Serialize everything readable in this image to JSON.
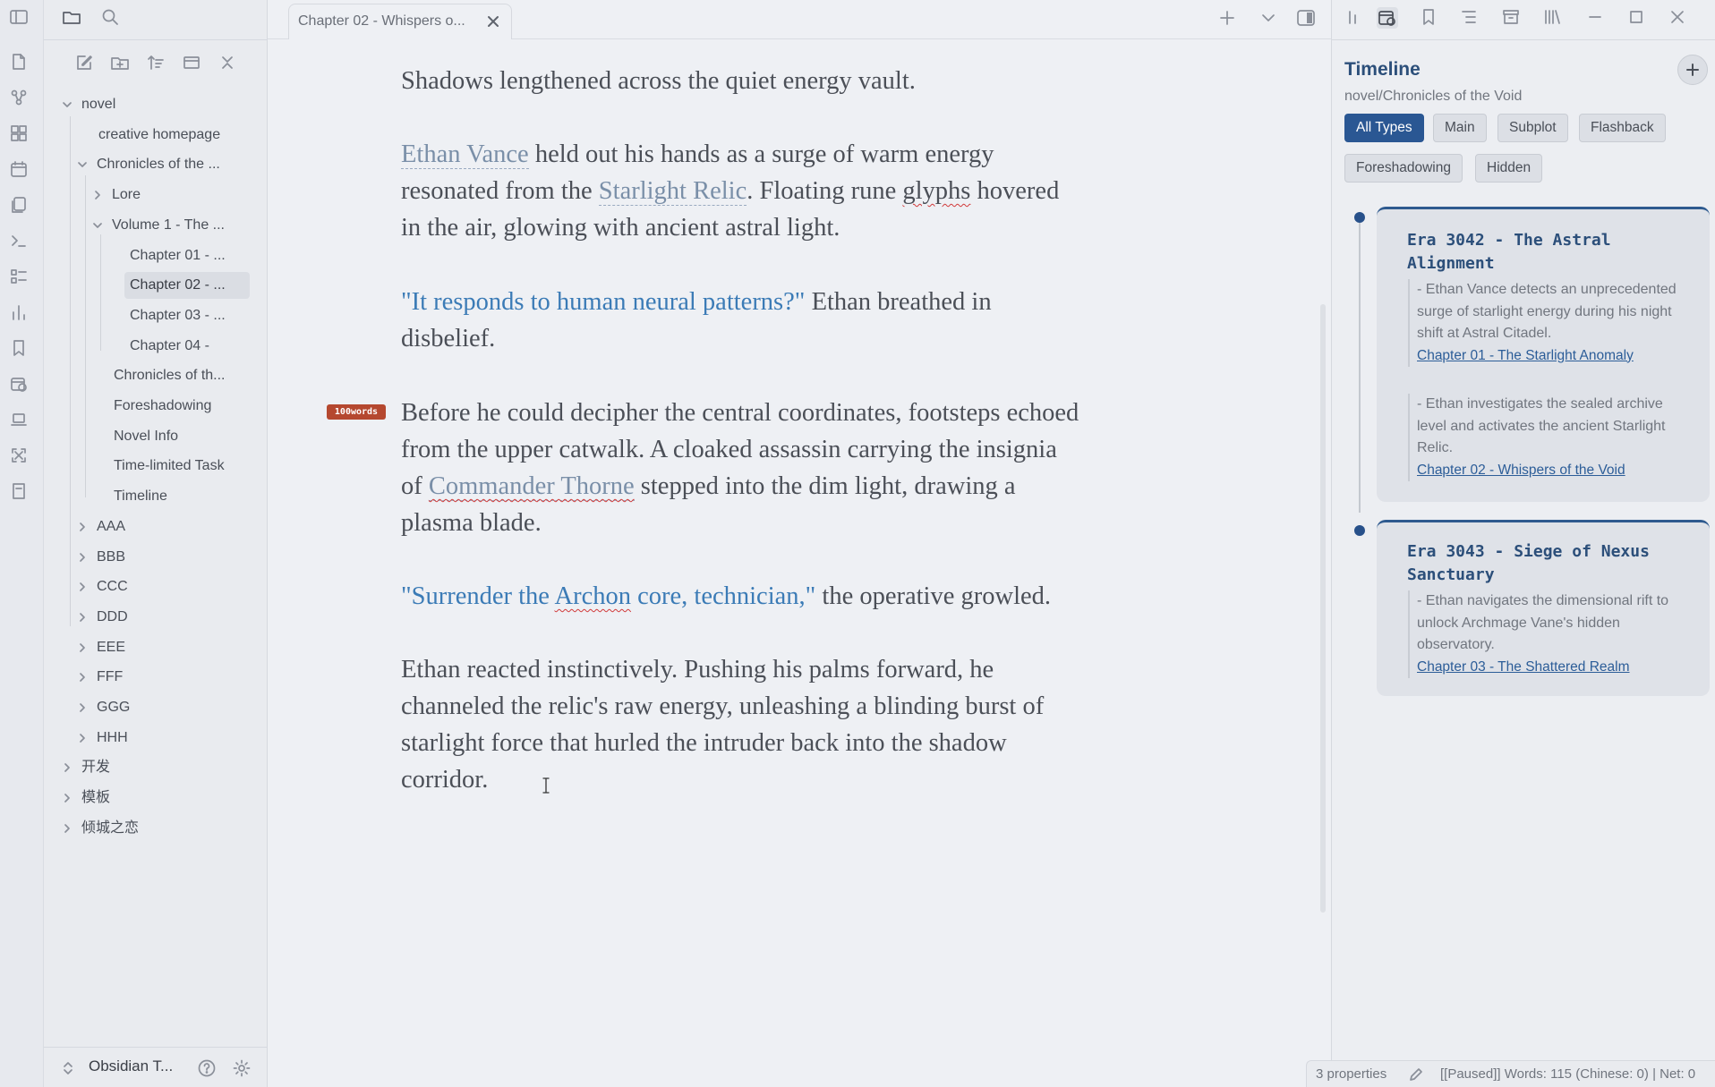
{
  "ribbon": {
    "icons": [
      "file-icon",
      "graph-icon",
      "canvas-icon",
      "calendar-icon",
      "pages-icon",
      "terminal-icon",
      "tasks-icon",
      "stats-icon",
      "bookmark-icon",
      "calendar-clock-icon",
      "laptop-icon",
      "zoom-icon",
      "note-icon"
    ]
  },
  "explorer": {
    "tree": [
      {
        "label": "novel",
        "expanded": true
      },
      {
        "label": "creative homepage"
      },
      {
        "label": "Chronicles of the ...",
        "expanded": true
      },
      {
        "label": "Lore",
        "collapsed": true
      },
      {
        "label": "Volume 1 - The ...",
        "expanded": true
      },
      {
        "label": "Chapter 01 - ..."
      },
      {
        "label": "Chapter 02 - ...",
        "active": true
      },
      {
        "label": "Chapter 03 - ..."
      },
      {
        "label": "Chapter 04 -"
      },
      {
        "label": "Chronicles of th..."
      },
      {
        "label": "Foreshadowing"
      },
      {
        "label": "Novel Info"
      },
      {
        "label": "Time-limited Task"
      },
      {
        "label": "Timeline"
      },
      {
        "label": "AAA"
      },
      {
        "label": "BBB"
      },
      {
        "label": "CCC"
      },
      {
        "label": "DDD"
      },
      {
        "label": "EEE"
      },
      {
        "label": "FFF"
      },
      {
        "label": "GGG"
      },
      {
        "label": "HHH"
      },
      {
        "label": "开发"
      },
      {
        "label": "模板"
      },
      {
        "label": "倾城之恋"
      }
    ],
    "vault_name": "Obsidian T..."
  },
  "editor": {
    "tab_title": "Chapter 02 - Whispers o...",
    "p1": "Shadows lengthened across the quiet energy vault.",
    "p2": {
      "link1": "Ethan Vance",
      "text1": " held out his hands as a surge of warm energy resonated from the ",
      "link2": "Starlight Relic",
      "text2": ". Floating rune ",
      "squig": "glyphs",
      "text3": " hovered in the air, glowing with ancient astral light."
    },
    "p3": {
      "quote": "\"It responds to human neural patterns?\"",
      "text": " Ethan breathed in disbelief."
    },
    "badge": "100words",
    "p4": {
      "text1": "Before he could decipher the central coordinates, footsteps echoed from the upper catwalk. A cloaked assassin carrying the insignia of ",
      "link1": "Commander Thorne",
      "text2": " stepped into the dim light, drawing a plasma blade."
    },
    "p5": {
      "quote_a": "\"Surrender the ",
      "squig": "Archon",
      "quote_b": " core, technician,\"",
      "text": " the operative growled."
    },
    "p6": "Ethan reacted instinctively. Pushing his palms forward, he channeled the relic's raw energy, unleashing a blinding burst of starlight force that hurled the intruder back into the shadow corridor."
  },
  "timeline": {
    "title": "Timeline",
    "path": "novel/Chronicles of the Void",
    "filters": [
      "All Types",
      "Main",
      "Subplot",
      "Flashback",
      "Foreshadowing",
      "Hidden"
    ],
    "active_filter": "All Types",
    "eras": [
      {
        "title": "Era 3042 - The Astral Alignment",
        "events": [
          {
            "text": "- Ethan Vance detects an unprecedented surge of starlight energy during his night shift at Astral Citadel.",
            "chapter": "Chapter 01 - The Starlight Anomaly"
          },
          {
            "text": "- Ethan investigates the sealed archive level and activates the ancient Starlight Relic.",
            "chapter": "Chapter 02 - Whispers of the Void"
          }
        ]
      },
      {
        "title": "Era 3043 - Siege of Nexus Sanctuary",
        "events": [
          {
            "text": "- Ethan navigates the dimensional rift to unlock Archmage Vane's hidden observatory.",
            "chapter": "Chapter 03 - The Shattered Realm"
          }
        ]
      }
    ]
  },
  "status": {
    "properties": "3 properties",
    "words": "[[Paused]] Words: 115 (Chinese: 0) | Net: 0"
  },
  "colors": {
    "accent": "#2a5793",
    "quote": "#3b7bb6",
    "badge": "#b5482f"
  }
}
